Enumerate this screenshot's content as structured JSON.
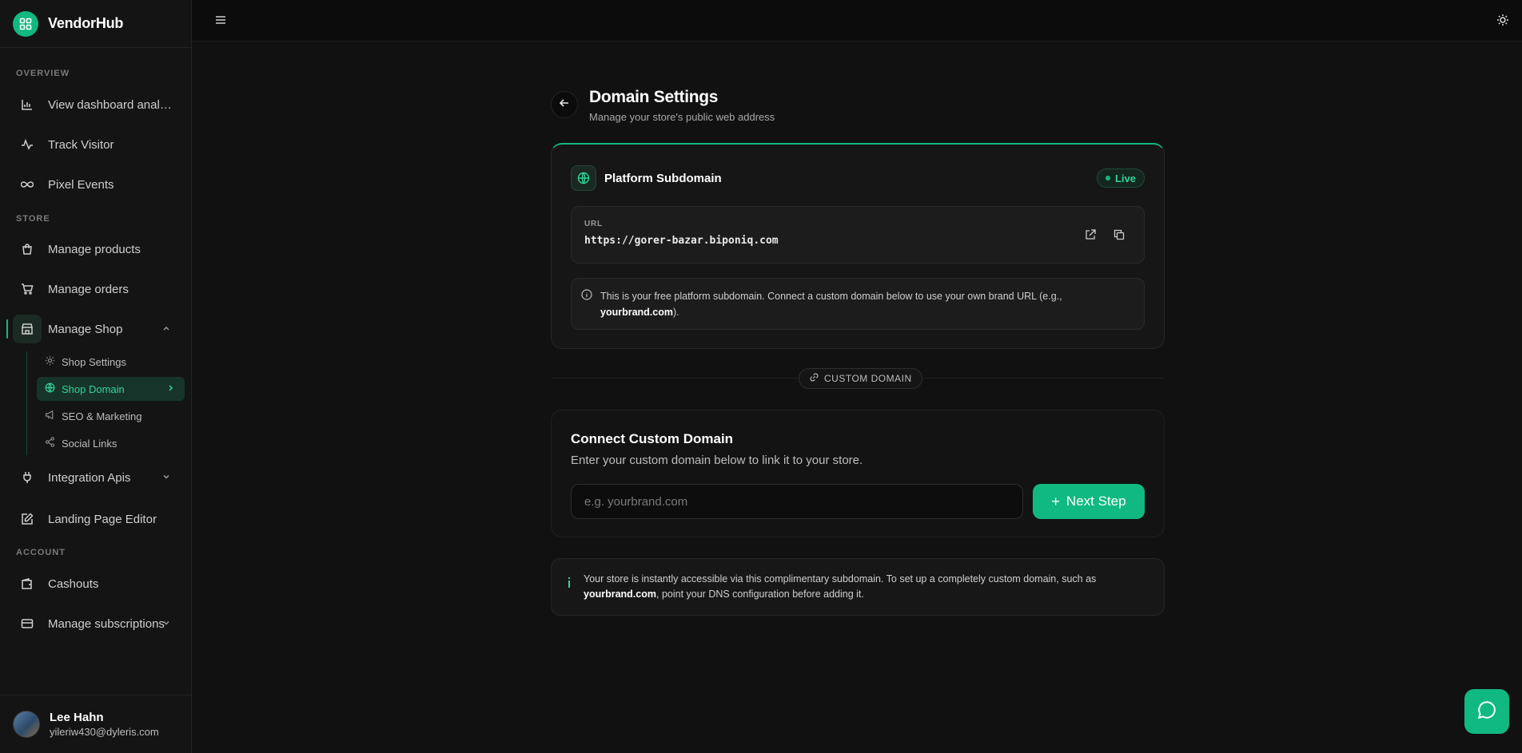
{
  "brand": {
    "name": "VendorHub"
  },
  "sidebar": {
    "sections": {
      "overview": "OVERVIEW",
      "store": "STORE",
      "account": "ACCOUNT"
    },
    "items": [
      {
        "label": "View dashboard analytics",
        "icon": "bar-chart-icon"
      },
      {
        "label": "Track Visitor",
        "icon": "activity-icon"
      },
      {
        "label": "Pixel Events",
        "icon": "infinity-icon"
      },
      {
        "label": "Manage products",
        "icon": "shopping-bag-icon"
      },
      {
        "label": "Manage orders",
        "icon": "cart-icon"
      },
      {
        "label": "Manage Shop",
        "icon": "store-icon"
      },
      {
        "label": "Integration Apis",
        "icon": "plug-icon"
      },
      {
        "label": "Landing Page Editor",
        "icon": "edit-icon"
      },
      {
        "label": "Cashouts",
        "icon": "wallet-icon"
      },
      {
        "label": "Manage subscriptions",
        "icon": "credit-card-icon"
      }
    ],
    "sub_items": [
      {
        "label": "Shop Settings",
        "icon": "gear-icon"
      },
      {
        "label": "Shop Domain",
        "icon": "globe-icon"
      },
      {
        "label": "SEO & Marketing",
        "icon": "megaphone-icon"
      },
      {
        "label": "Social Links",
        "icon": "share-icon"
      }
    ]
  },
  "user": {
    "name": "Lee Hahn",
    "email": "yileriw430@dyleris.com"
  },
  "page": {
    "title": "Domain Settings",
    "subtitle": "Manage your store's public web address"
  },
  "platform": {
    "title": "Platform Subdomain",
    "status": "Live",
    "url_label": "URL",
    "url": "https://gorer-bazar.biponiq.com",
    "note_prefix": "This is your free platform subdomain. Connect a custom domain below to use your own brand URL (e.g.,",
    "note_domain": "yourbrand.com",
    "note_suffix": ")."
  },
  "divider": {
    "label": "CUSTOM DOMAIN"
  },
  "custom": {
    "title": "Connect Custom Domain",
    "subtitle": "Enter your custom domain below to link it to your store.",
    "placeholder": "e.g. yourbrand.com",
    "button": "Next Step"
  },
  "info": {
    "prefix": "Your store is instantly accessible via this complimentary subdomain. To set up a completely custom domain, such as",
    "domain": "yourbrand.com",
    "suffix": ", point your DNS configuration before adding it."
  },
  "colors": {
    "accent": "#10b981",
    "background": "#111111"
  }
}
